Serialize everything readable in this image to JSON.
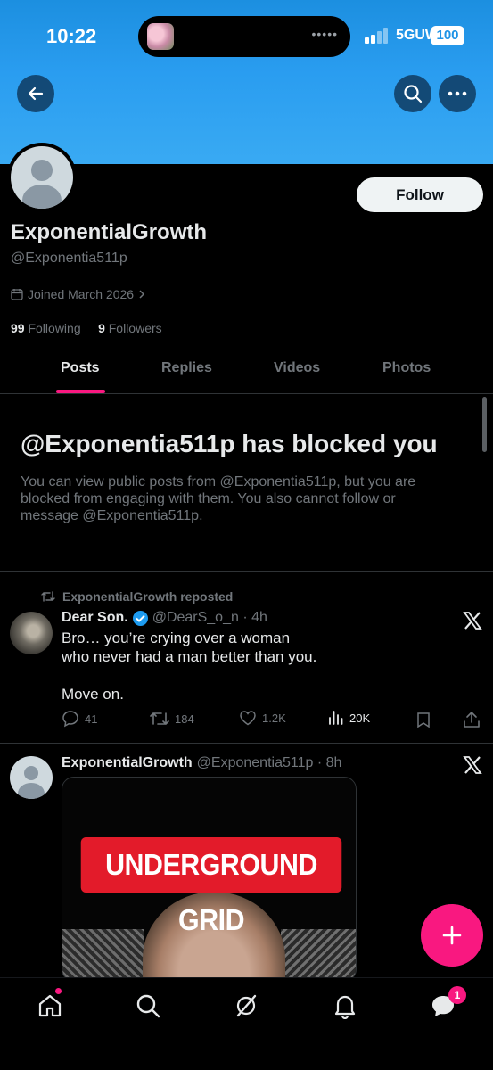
{
  "status_bar": {
    "time": "10:22",
    "network": "5GUW",
    "battery": "100"
  },
  "profile": {
    "display_name": "ExponentialGrowth",
    "handle": "@Exponentia511p",
    "joined": "Joined March 2026",
    "following_count": "99",
    "following_label": "Following",
    "followers_count": "9",
    "followers_label": "Followers",
    "follow_label": "Follow"
  },
  "tabs": [
    {
      "label": "Posts",
      "active": true
    },
    {
      "label": "Replies"
    },
    {
      "label": "Videos"
    },
    {
      "label": "Photos"
    }
  ],
  "blocked": {
    "title": "@Exponentia511p has blocked you",
    "text": "You can view public posts from @Exponentia511p, but you are blocked from engaging with them. You also cannot follow or message @Exponentia511p."
  },
  "posts": [
    {
      "repost_label": "ExponentialGrowth reposted",
      "author": "Dear Son.",
      "verified": true,
      "handle_time": "@DearS_o_n · 4h",
      "text": "Bro… you’re crying over a woman\nwho never had a man better than you.\n\nMove on.",
      "replies": "41",
      "reposts": "184",
      "likes": "1.2K",
      "views": "20K"
    },
    {
      "author": "ExponentialGrowth",
      "handle_time": "@Exponentia511p · 8h",
      "media_text": "UNDERGROUND GRID"
    }
  ],
  "nav": {
    "messages_badge": "1"
  },
  "colors": {
    "accent": "#f91880",
    "blue": "#1d9bf0",
    "banner": "#2a9df0"
  }
}
